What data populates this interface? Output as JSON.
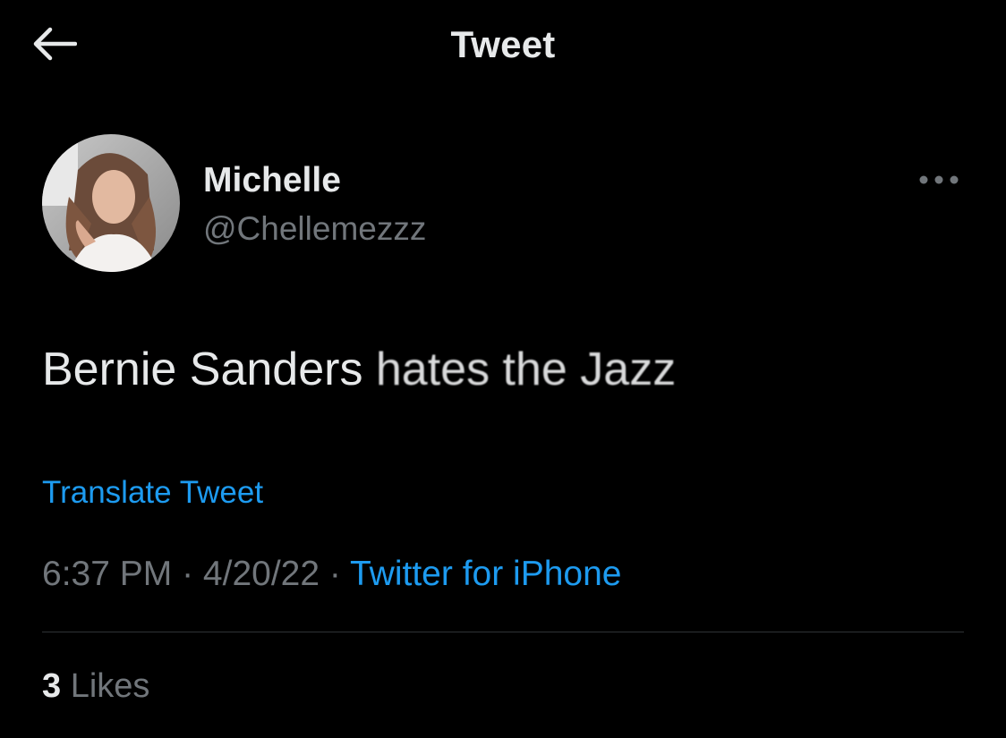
{
  "header": {
    "title": "Tweet",
    "back_icon": "arrow-left-icon"
  },
  "author": {
    "display_name": "Michelle",
    "handle": "@Chellemezzz",
    "avatar_icon": "profile-photo"
  },
  "tweet": {
    "text_part1": "Bernie Sanders ",
    "text_part2": "hates the Jazz",
    "translate_label": "Translate Tweet",
    "time": "6:37 PM",
    "separator": " · ",
    "date": "4/20/22",
    "source": "Twitter for iPhone"
  },
  "stats": {
    "likes_count": "3",
    "likes_label": " Likes"
  },
  "colors": {
    "background": "#000000",
    "primary_text": "#e7e9ea",
    "secondary_text": "#71767b",
    "link": "#1d9bf0",
    "divider": "#2f3336"
  }
}
